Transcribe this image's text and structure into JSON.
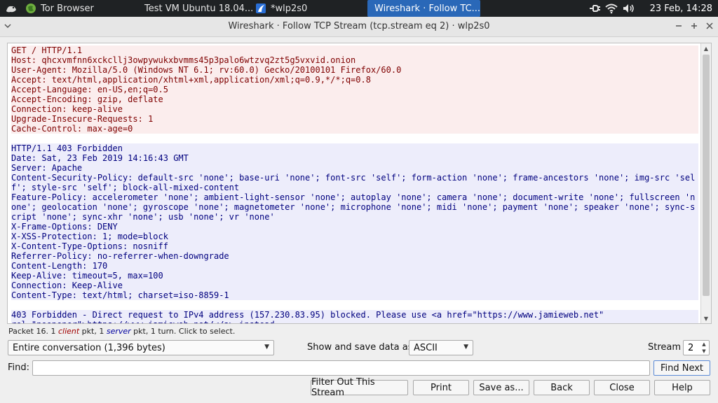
{
  "taskbar": {
    "tasks": [
      {
        "label": "Tor Browser"
      },
      {
        "label": "Test VM Ubuntu 18.04..."
      },
      {
        "label": "*wlp2s0"
      },
      {
        "label": "Wireshark · Follow TC..."
      }
    ],
    "clock": "23 Feb, 14:28"
  },
  "window": {
    "title": "Wireshark · Follow TCP Stream (tcp.stream eq 2) · wlp2s0"
  },
  "stream": {
    "client_lines": [
      "GET / HTTP/1.1",
      "Host: qhcxvmfnn6xckcllj3owpywukxbvmms45p3palo6wtzvq2zt5g5vxvid.onion",
      "User-Agent: Mozilla/5.0 (Windows NT 6.1; rv:60.0) Gecko/20100101 Firefox/60.0",
      "Accept: text/html,application/xhtml+xml,application/xml;q=0.9,*/*;q=0.8",
      "Accept-Language: en-US,en;q=0.5",
      "Accept-Encoding: gzip, deflate",
      "Connection: keep-alive",
      "Upgrade-Insecure-Requests: 1",
      "Cache-Control: max-age=0"
    ],
    "server_lines": [
      "HTTP/1.1 403 Forbidden",
      "Date: Sat, 23 Feb 2019 14:16:43 GMT",
      "Server: Apache",
      "Content-Security-Policy: default-src 'none'; base-uri 'none'; font-src 'self'; form-action 'none'; frame-ancestors 'none'; img-src 'self'; style-src 'self'; block-all-mixed-content",
      "Feature-Policy: accelerometer 'none'; ambient-light-sensor 'none'; autoplay 'none'; camera 'none'; document-write 'none'; fullscreen 'none'; geolocation 'none'; gyroscope 'none'; magnetometer 'none'; microphone 'none'; midi 'none'; payment 'none'; speaker 'none'; sync-script 'none'; sync-xhr 'none'; usb 'none'; vr 'none'",
      "X-Frame-Options: DENY",
      "X-XSS-Protection: 1; mode=block",
      "X-Content-Type-Options: nosniff",
      "Referrer-Policy: no-referrer-when-downgrade",
      "Content-Length: 170",
      "Keep-Alive: timeout=5, max=100",
      "Connection: Keep-Alive",
      "Content-Type: text/html; charset=iso-8859-1"
    ],
    "body_lines": [
      "403 Forbidden - Direct request to IPv4 address (157.230.83.95) blocked. Please use <a href=\"https://www.jamieweb.net\"",
      "rel=\"noopener\">https://www.jamieweb.net/</a> instead."
    ]
  },
  "status": {
    "prefix": "Packet 16. 1 ",
    "client_word": "client",
    "mid1": " pkt, 1 ",
    "server_word": "server",
    "suffix": " pkt, 1 turn. Click to select."
  },
  "controls": {
    "conversation": "Entire conversation (1,396 bytes)",
    "show_save_label": "Show and save data as",
    "format": "ASCII",
    "stream_label": "Stream",
    "stream_value": "2",
    "find_label": "Find:",
    "find_value": "",
    "find_next": "Find Next"
  },
  "buttons": {
    "filter_out": "Filter Out This Stream",
    "print": "Print",
    "save_as": "Save as...",
    "back": "Back",
    "close": "Close",
    "help": "Help"
  }
}
